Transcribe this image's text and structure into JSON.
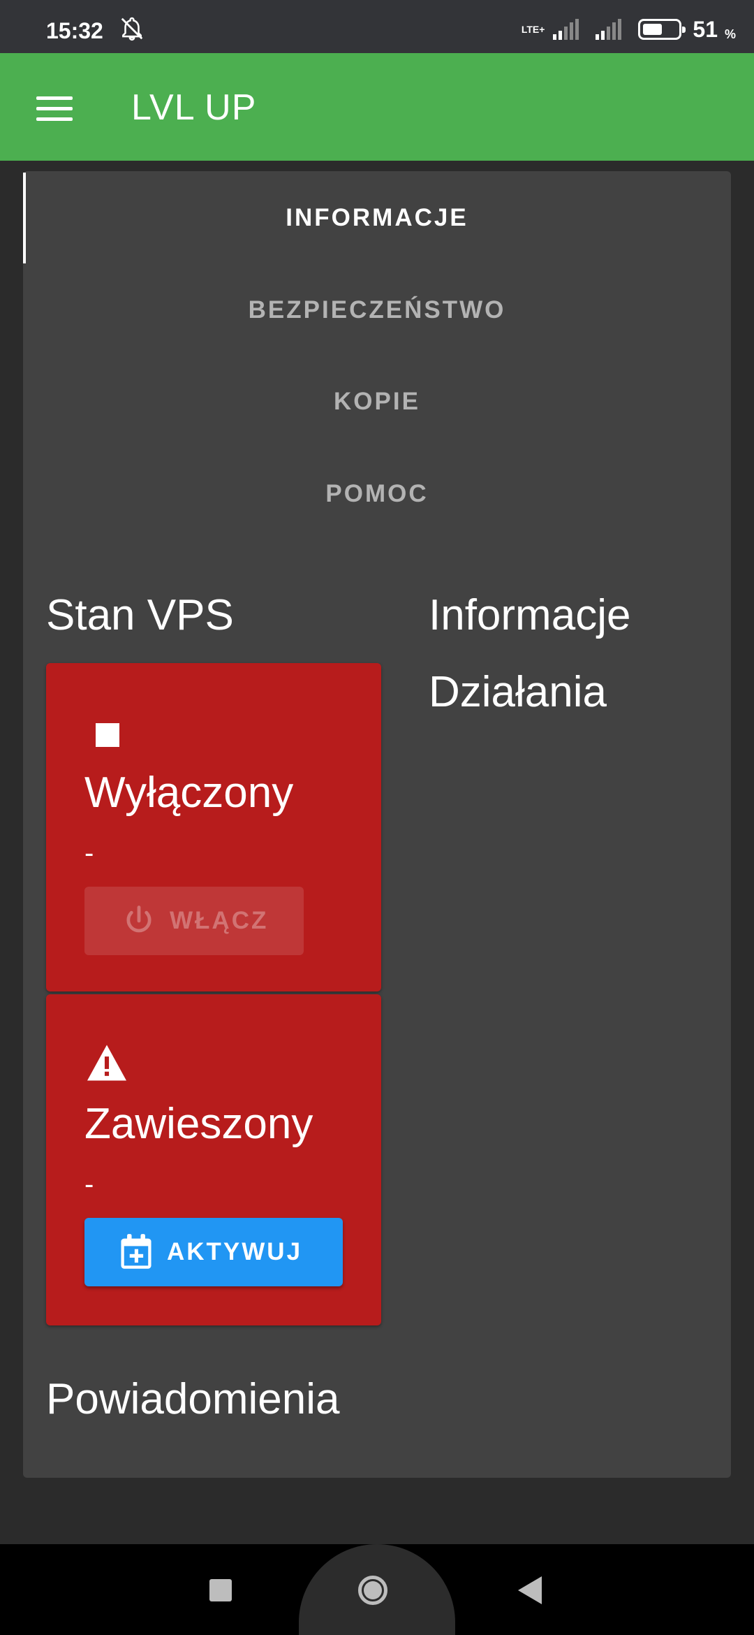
{
  "status_bar": {
    "time": "15:32",
    "network": "LTE+",
    "battery_level": "51",
    "battery_unit": "%",
    "icons": [
      "dnd-off-icon",
      "signal-icon",
      "signal-icon",
      "battery-icon"
    ]
  },
  "app_bar": {
    "title": "LVL UP",
    "menu_icon": "hamburger-menu-icon",
    "color": "#4caf50"
  },
  "tabs": [
    {
      "label": "INFORMACJE",
      "active": true
    },
    {
      "label": "BEZPIECZEŃSTWO",
      "active": false
    },
    {
      "label": "KOPIE",
      "active": false
    },
    {
      "label": "POMOC",
      "active": false
    }
  ],
  "sections": {
    "stan_vps": "Stan VPS",
    "informacje": "Informacje",
    "dzialania": "Działania",
    "powiadomienia": "Powiadomienia"
  },
  "vps_state": {
    "title": "Wyłączony",
    "detail": "-",
    "icon": "stop-icon",
    "button_label": "WŁĄCZ",
    "button_icon": "power-icon",
    "button_enabled": false,
    "card_color": "#b71c1c"
  },
  "suspension": {
    "title": "Zawieszony",
    "detail": "-",
    "icon": "warning-icon",
    "button_label": "AKTYWUJ",
    "button_icon": "calendar-plus-icon",
    "button_color": "#2196f3"
  }
}
